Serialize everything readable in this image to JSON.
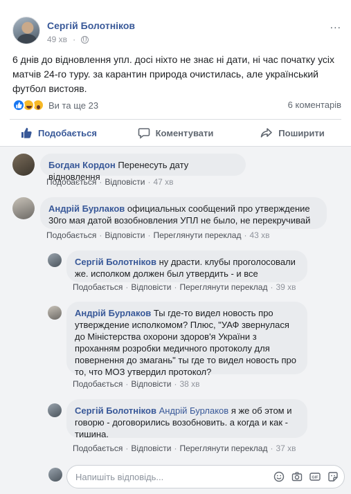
{
  "post": {
    "author": "Сергій Болотніков",
    "time": "49 хв",
    "more_glyph": "...",
    "text": "6 днів до відновлення упл. досі ніхто не знає ні дати, ні час початку усіх матчів 24-го туру. за карантин природа очистилась, але український футбол вистояв.",
    "reactions_text": "Ви та ще 23",
    "comments_count": "6 коментарів"
  },
  "actions": {
    "like": "Подобається",
    "comment": "Коментувати",
    "share": "Поширити"
  },
  "comment_links": {
    "like": "Подобається",
    "reply": "Відповісти",
    "translate": "Переглянути переклад"
  },
  "comments": [
    {
      "author": "Богдан Кордон",
      "text": "Перенесуть дату відновлення",
      "time": "47 хв"
    },
    {
      "author": "Андрій Бурлаков",
      "text": "официальных сообщений про утверждение 30го мая датой возобновления УПЛ не было, не перекручивай",
      "time": "43 хв"
    },
    {
      "author": "Сергій Болотніков",
      "text": "ну драсти. клубы проголосовали же. исполком должен был утвердить - и все",
      "time": "39 хв"
    },
    {
      "author": "Андрій Бурлаков",
      "text": "Ты где-то видел новость про утверждение исполкомом? Плюс, \"УАФ звернулася до Міністерства охорони здоров'я України з проханням розробки медичного протоколу для повернення до змагань\" ты где то видел новость про то, что МОЗ утвердил протокол?",
      "time": "38 хв"
    },
    {
      "author": "Сергій Болотніков",
      "tag": "Андрій Бурлаков",
      "text": "я же об этом и говорю - договорились возобновить. а когда и как - тишина.",
      "time": "37 хв"
    }
  ],
  "reply": {
    "placeholder": "Напишіть відповідь..."
  },
  "colors": {
    "link_blue": "#385898",
    "facebook_blue": "#1877f2",
    "bubble_gray": "#e9ebee",
    "comments_bg": "#f2f3f5"
  }
}
